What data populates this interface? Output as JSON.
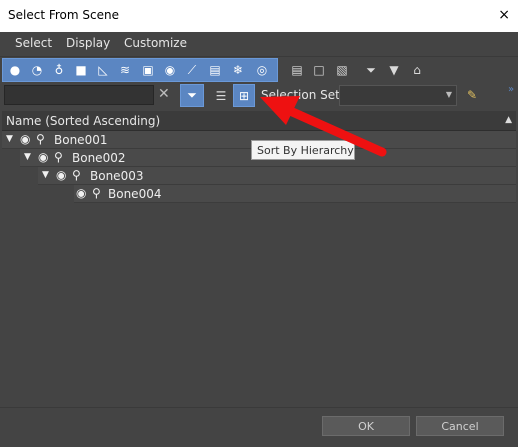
{
  "window": {
    "title": "Select From Scene",
    "close_glyph": "×"
  },
  "menu": [
    "Select",
    "Display",
    "Customize"
  ],
  "toolbar": {
    "filter_icons": [
      "geometry-icon",
      "shapes-icon",
      "lights-icon",
      "cameras-icon",
      "helpers-icon",
      "spacewarps-icon",
      "groups-icon",
      "xrefs-icon",
      "bones-icon",
      "containers-icon",
      "frozen-icon",
      "hidden-icon"
    ],
    "display_icons": [
      "display-all-icon",
      "display-none-icon",
      "invert-display-icon"
    ],
    "filter_tools": [
      "filter-funnel-icon",
      "filter-icon",
      "folder-icon"
    ]
  },
  "search": {
    "value": "",
    "placeholder": ""
  },
  "selection_set": {
    "label": "Selection Set:",
    "value": ""
  },
  "list": {
    "header": "Name (Sorted Ascending)",
    "sort_indicator": "▲",
    "rows": [
      {
        "name": "Bone001",
        "expanded": true
      },
      {
        "name": "Bone002",
        "expanded": true
      },
      {
        "name": "Bone003",
        "expanded": true
      },
      {
        "name": "Bone004",
        "expanded": false
      }
    ]
  },
  "tooltip": "Sort By Hierarchy",
  "footer": {
    "ok": "OK",
    "cancel": "Cancel"
  },
  "colors": {
    "accent": "#5b86c2",
    "background": "#444444",
    "annotation_arrow": "#ee1111"
  }
}
